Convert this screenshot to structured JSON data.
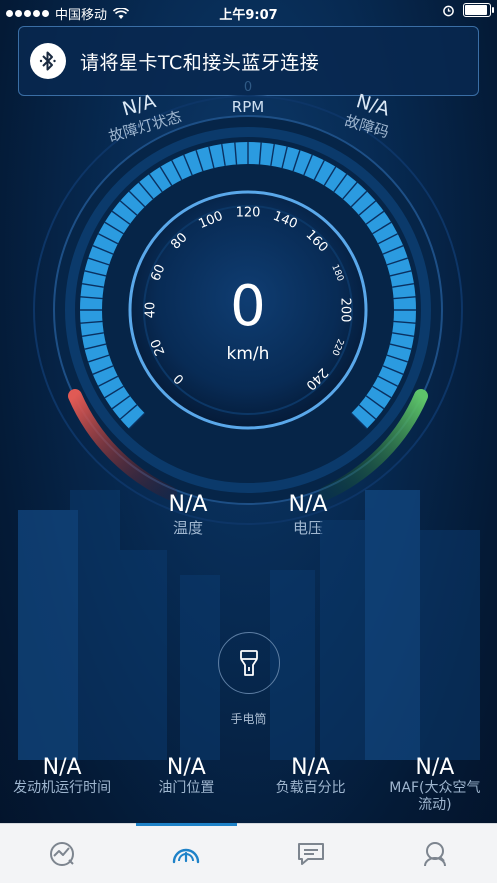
{
  "status_bar": {
    "carrier": "中国移动",
    "time": "上午9:07",
    "icons": [
      "signal-dots-icon",
      "wifi-icon",
      "alarm-icon",
      "battery-icon"
    ]
  },
  "banner": {
    "icon": "bluetooth-icon",
    "text": "请将星卡TC和接头蓝牙连接"
  },
  "gauge": {
    "rpm_value": "0",
    "rpm_label": "RPM",
    "left_top_value": "N/A",
    "left_top_label": "故障灯状态",
    "right_top_value": "N/A",
    "right_top_label": "故障码",
    "speed_value": "0",
    "speed_unit": "km/h",
    "ticks": [
      "0",
      "20",
      "40",
      "60",
      "80",
      "100",
      "120",
      "140",
      "160",
      "180",
      "200",
      "220",
      "240"
    ],
    "colors": {
      "blue": "#2b9be0",
      "red": "#d9403a",
      "green": "#3fa650"
    }
  },
  "mid_stats": [
    {
      "value": "N/A",
      "label": "温度"
    },
    {
      "value": "N/A",
      "label": "电压"
    }
  ],
  "flashlight": {
    "icon": "flashlight-icon",
    "label": "手电筒"
  },
  "bottom_stats": [
    {
      "value": "N/A",
      "label": "发动机运行时间"
    },
    {
      "value": "N/A",
      "label": "油门位置"
    },
    {
      "value": "N/A",
      "label": "负载百分比"
    },
    {
      "value": "N/A",
      "label": "MAF(大众空气流动)"
    }
  ],
  "tabs": [
    {
      "icon": "trend-chart-icon",
      "active": false
    },
    {
      "icon": "gauge-icon",
      "active": true
    },
    {
      "icon": "chat-icon",
      "active": false
    },
    {
      "icon": "profile-search-icon",
      "active": false
    }
  ]
}
